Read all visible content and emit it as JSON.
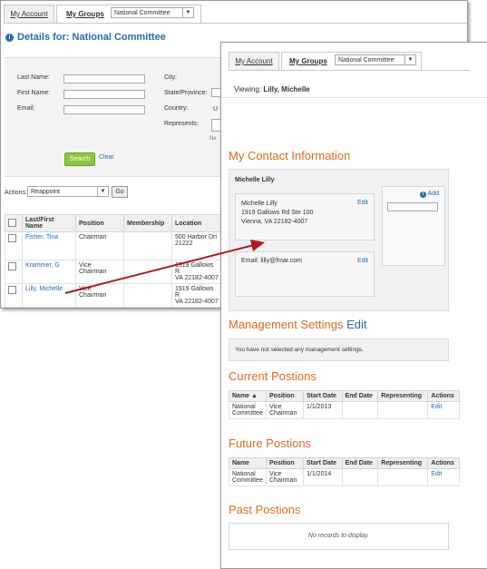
{
  "back_window": {
    "tabs": [
      {
        "label": "My Account"
      },
      {
        "label": "My Groups"
      }
    ],
    "group_select": "National Committee",
    "title_prefix": "Details for:",
    "title_name": "National Committee",
    "form": {
      "last_name": "Last Name:",
      "first_name": "First Name:",
      "email": "Email:",
      "city": "City:",
      "state": "State/Province:",
      "country": "Country:",
      "represents": "Represents:",
      "country_value": "U",
      "fragment_ne": "Ne"
    },
    "search_button": "Search",
    "clear_link": "Clear",
    "actions_label": "Actions:",
    "actions_select": "Reappoint",
    "go_button": "Go",
    "table": {
      "headers": [
        "Last/First Name",
        "Position",
        "Membership",
        "Location"
      ],
      "rows": [
        {
          "name": "Fisher, Tina",
          "position": "Chairman",
          "membership": "",
          "location": "500 Harbor Dri\n21222"
        },
        {
          "name": "Krammer, G",
          "position": "Vice\nChairman",
          "membership": "",
          "location": "1919 Gallows R\nVA 22182-4007"
        },
        {
          "name": "Lilly, Michelle",
          "position": "Vice\nChairman",
          "membership": "",
          "location": "1919 Gallows R\nVA 22182-4007"
        }
      ]
    }
  },
  "front_window": {
    "tabs": [
      {
        "label": "My Account"
      },
      {
        "label": "My Groups"
      }
    ],
    "group_select": "National Committee",
    "viewing_label": "Viewing:",
    "viewing_name": "Lilly, Michelle",
    "contact_heading": "My Contact Information",
    "contact": {
      "name": "Michelle Lilly",
      "address_lines": [
        "Michelle Lilly",
        "1919 Gallows Rd Ste 100",
        "Vienna, VA 22182-4007"
      ],
      "edit_label": "Edit",
      "email_text": "Email: lilly@fmar.com",
      "email_edit": "Edit",
      "add_label": "Add"
    },
    "management_heading": "Management Settings",
    "management_edit": "Edit",
    "management_text": "You have not selected any management settings.",
    "current_heading": "Current Postions",
    "future_heading": "Future Postions",
    "past_heading": "Past Postions",
    "position_headers": [
      "Name",
      "Position",
      "Start Date",
      "End Date",
      "Representing",
      "Actions"
    ],
    "current_rows": [
      {
        "name": "National Committee",
        "position": "Vice Chairman",
        "start": "1/1/2013",
        "end": "",
        "representing": "",
        "action": "Edit"
      }
    ],
    "future_rows": [
      {
        "name": "National Committee",
        "position": "Vice Chairman",
        "start": "1/1/2014",
        "end": "",
        "representing": "",
        "action": "Edit"
      }
    ],
    "no_records": "No records to display."
  },
  "colors": {
    "link_blue": "#2a6ab0",
    "heading_orange": "#e06a21",
    "search_green": "#8cc63f",
    "arrow_red": "#b01a1a"
  }
}
